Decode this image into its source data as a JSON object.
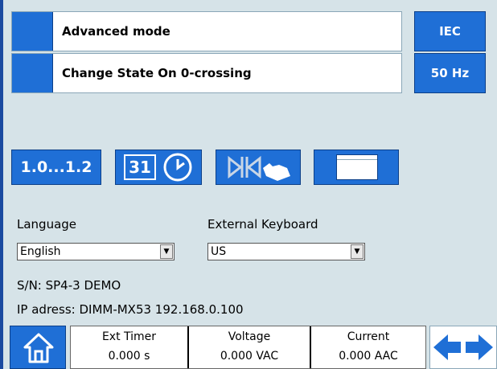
{
  "options": [
    {
      "label": "Advanced mode"
    },
    {
      "label": "Change State On 0-crossing"
    }
  ],
  "side_buttons": {
    "standard": "IEC",
    "frequency": "50 Hz"
  },
  "tools": {
    "range_label": "1.0...1.2",
    "calendar_day": "31"
  },
  "language": {
    "label": "Language",
    "value": "English"
  },
  "keyboard": {
    "label": "External Keyboard",
    "value": "US"
  },
  "info": {
    "serial": "S/N: SP4-3  DEMO",
    "ip": "IP adress: DIMM-MX53 192.168.0.100"
  },
  "status": [
    {
      "title": "Ext Timer",
      "value": "0.000 s"
    },
    {
      "title": "Voltage",
      "value": "0.000 VAC"
    },
    {
      "title": "Current",
      "value": "0.000 AAC"
    }
  ],
  "icons": [
    "home-icon",
    "arrow-left-icon",
    "arrow-right-icon",
    "clock-icon",
    "calendar-icon",
    "touch-hand-icon",
    "window-icon"
  ],
  "colors": {
    "accent": "#1f6fd6",
    "background": "#d6e3e8"
  }
}
